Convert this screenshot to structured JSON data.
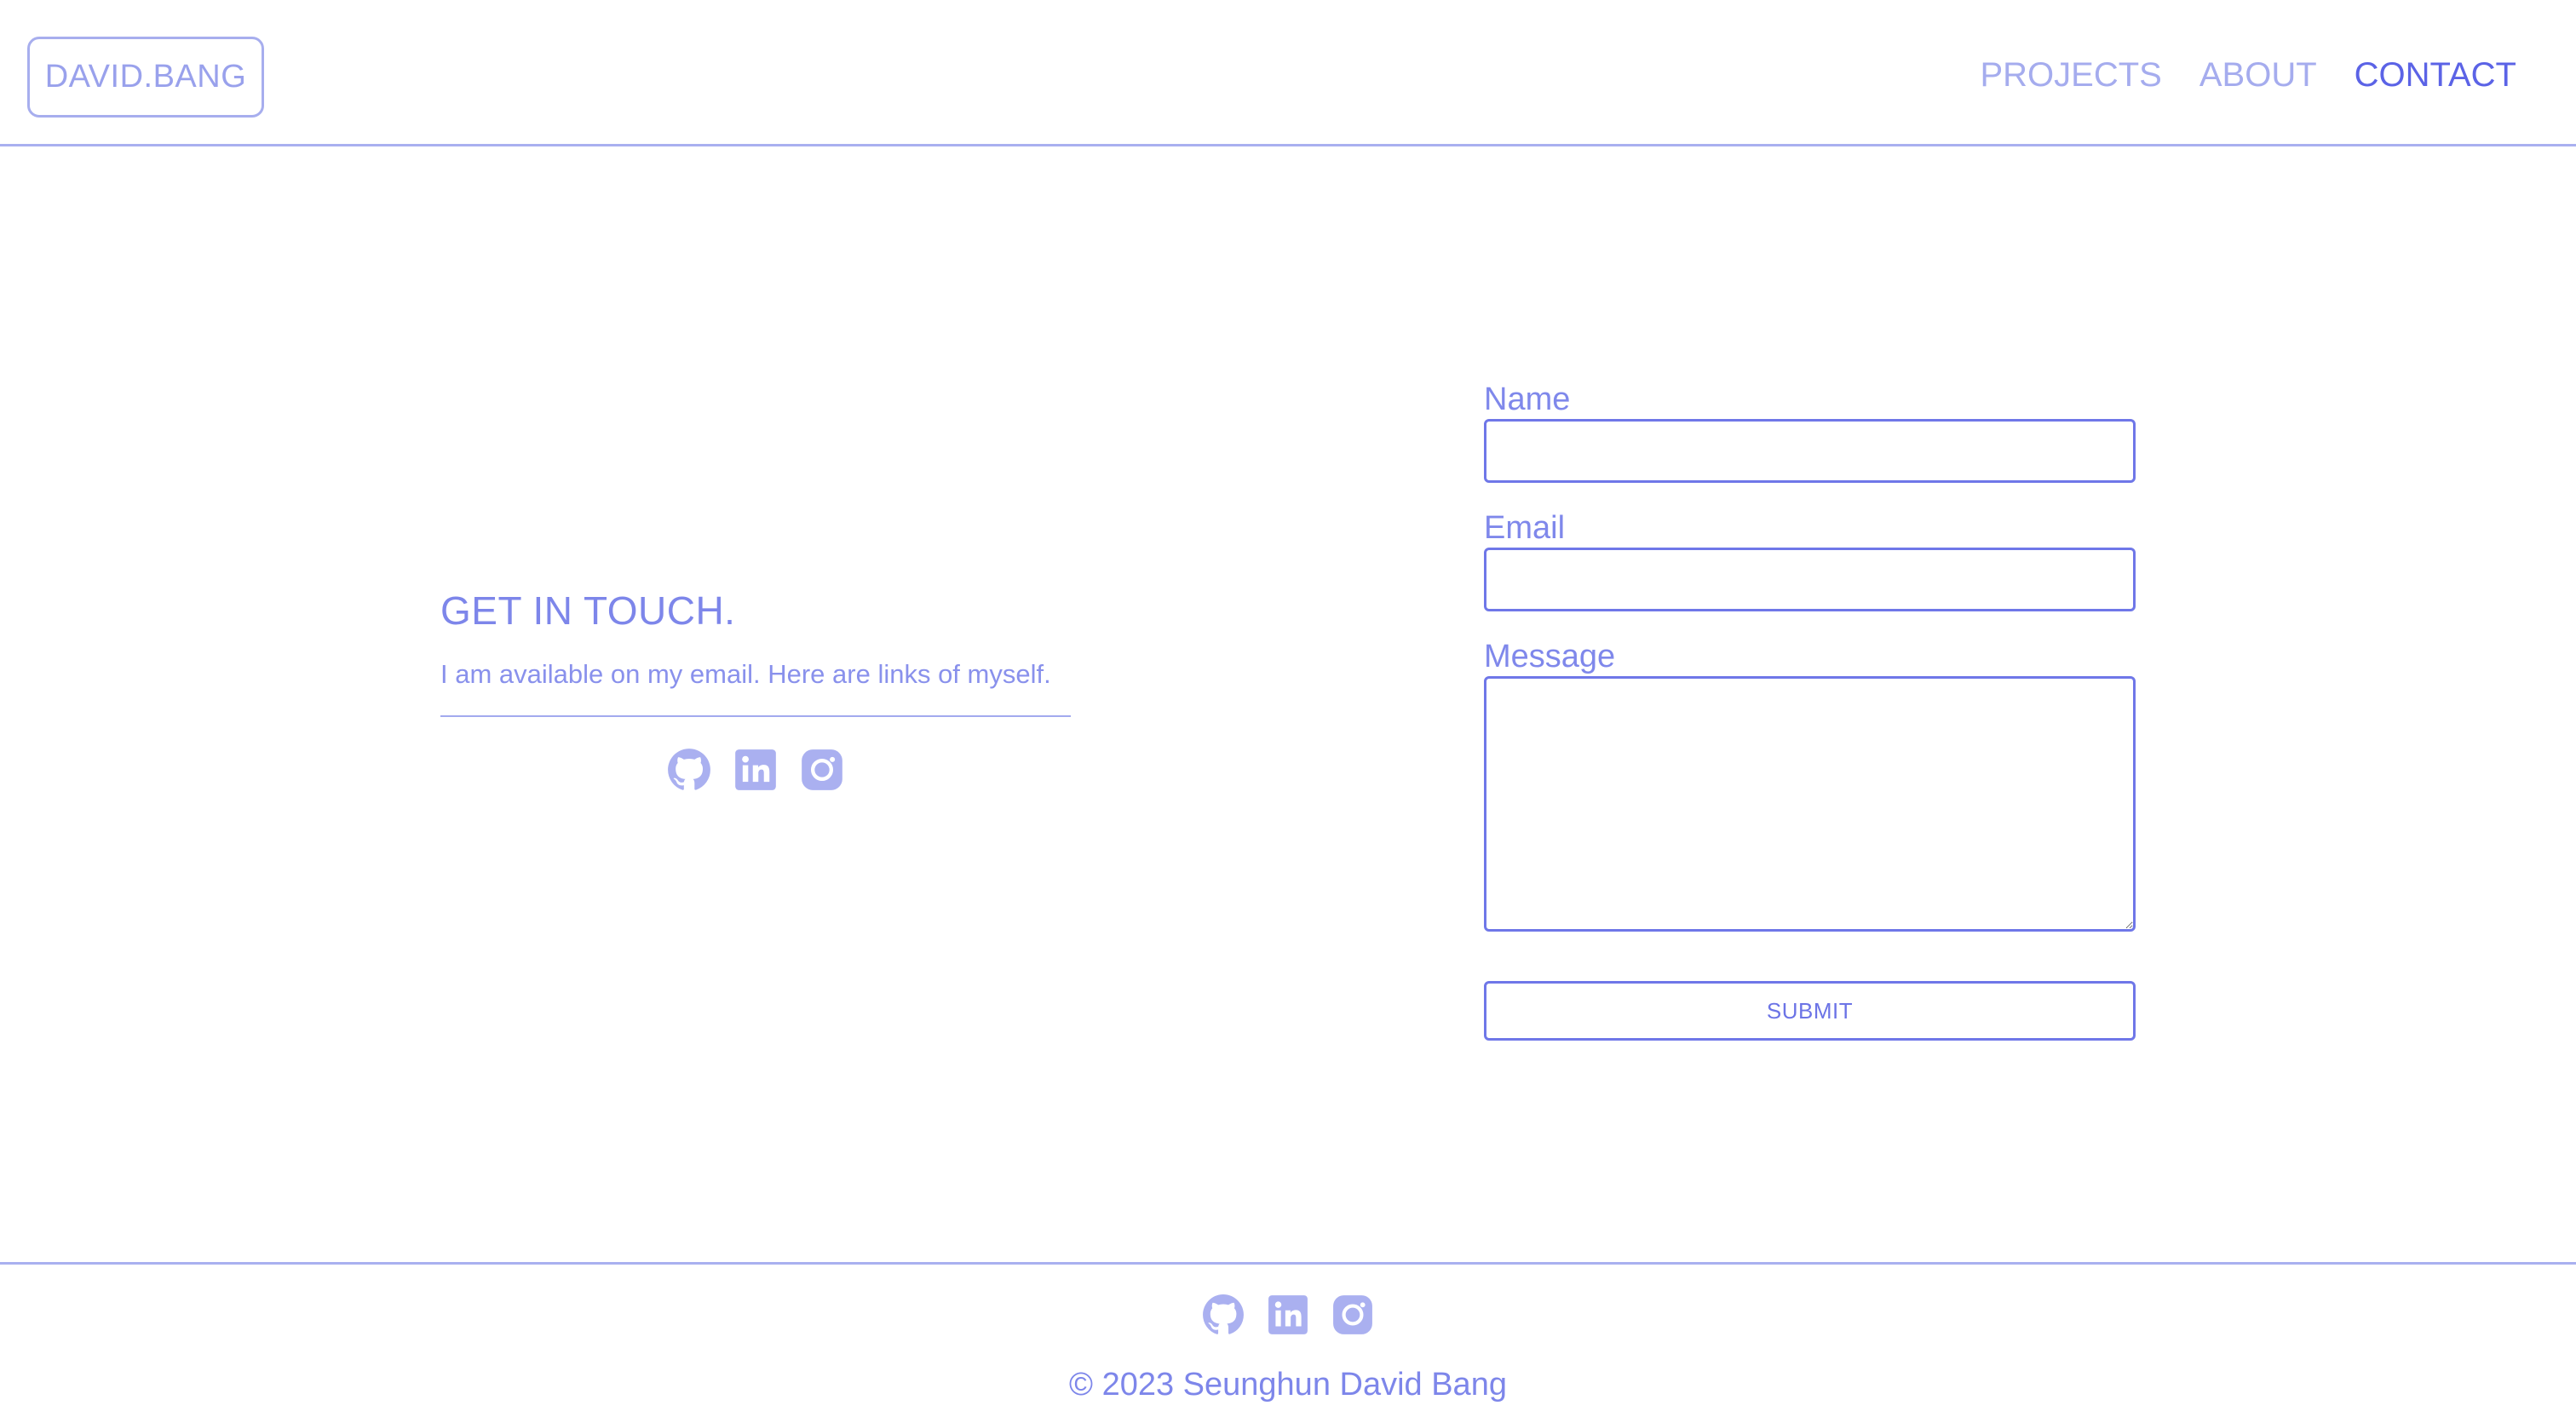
{
  "header": {
    "logo": "DAVID.BANG",
    "nav": [
      {
        "label": "PROJECTS",
        "active": false
      },
      {
        "label": "ABOUT",
        "active": false
      },
      {
        "label": "CONTACT",
        "active": true
      }
    ]
  },
  "intro": {
    "title": "GET IN TOUCH.",
    "text": "I am available on my email. Here are links of myself.",
    "social_icons": [
      "github-icon",
      "linkedin-icon",
      "instagram-icon"
    ]
  },
  "form": {
    "name_label": "Name",
    "name_value": "",
    "email_label": "Email",
    "email_value": "",
    "message_label": "Message",
    "message_value": "",
    "submit_label": "SUBMIT"
  },
  "footer": {
    "social_icons": [
      "github-icon",
      "linkedin-icon",
      "instagram-icon"
    ],
    "copyright": "© 2023 Seunghun David Bang"
  },
  "colors": {
    "accent": "#5b63e6",
    "text": "#7d86ea",
    "light": "#a5acee"
  }
}
